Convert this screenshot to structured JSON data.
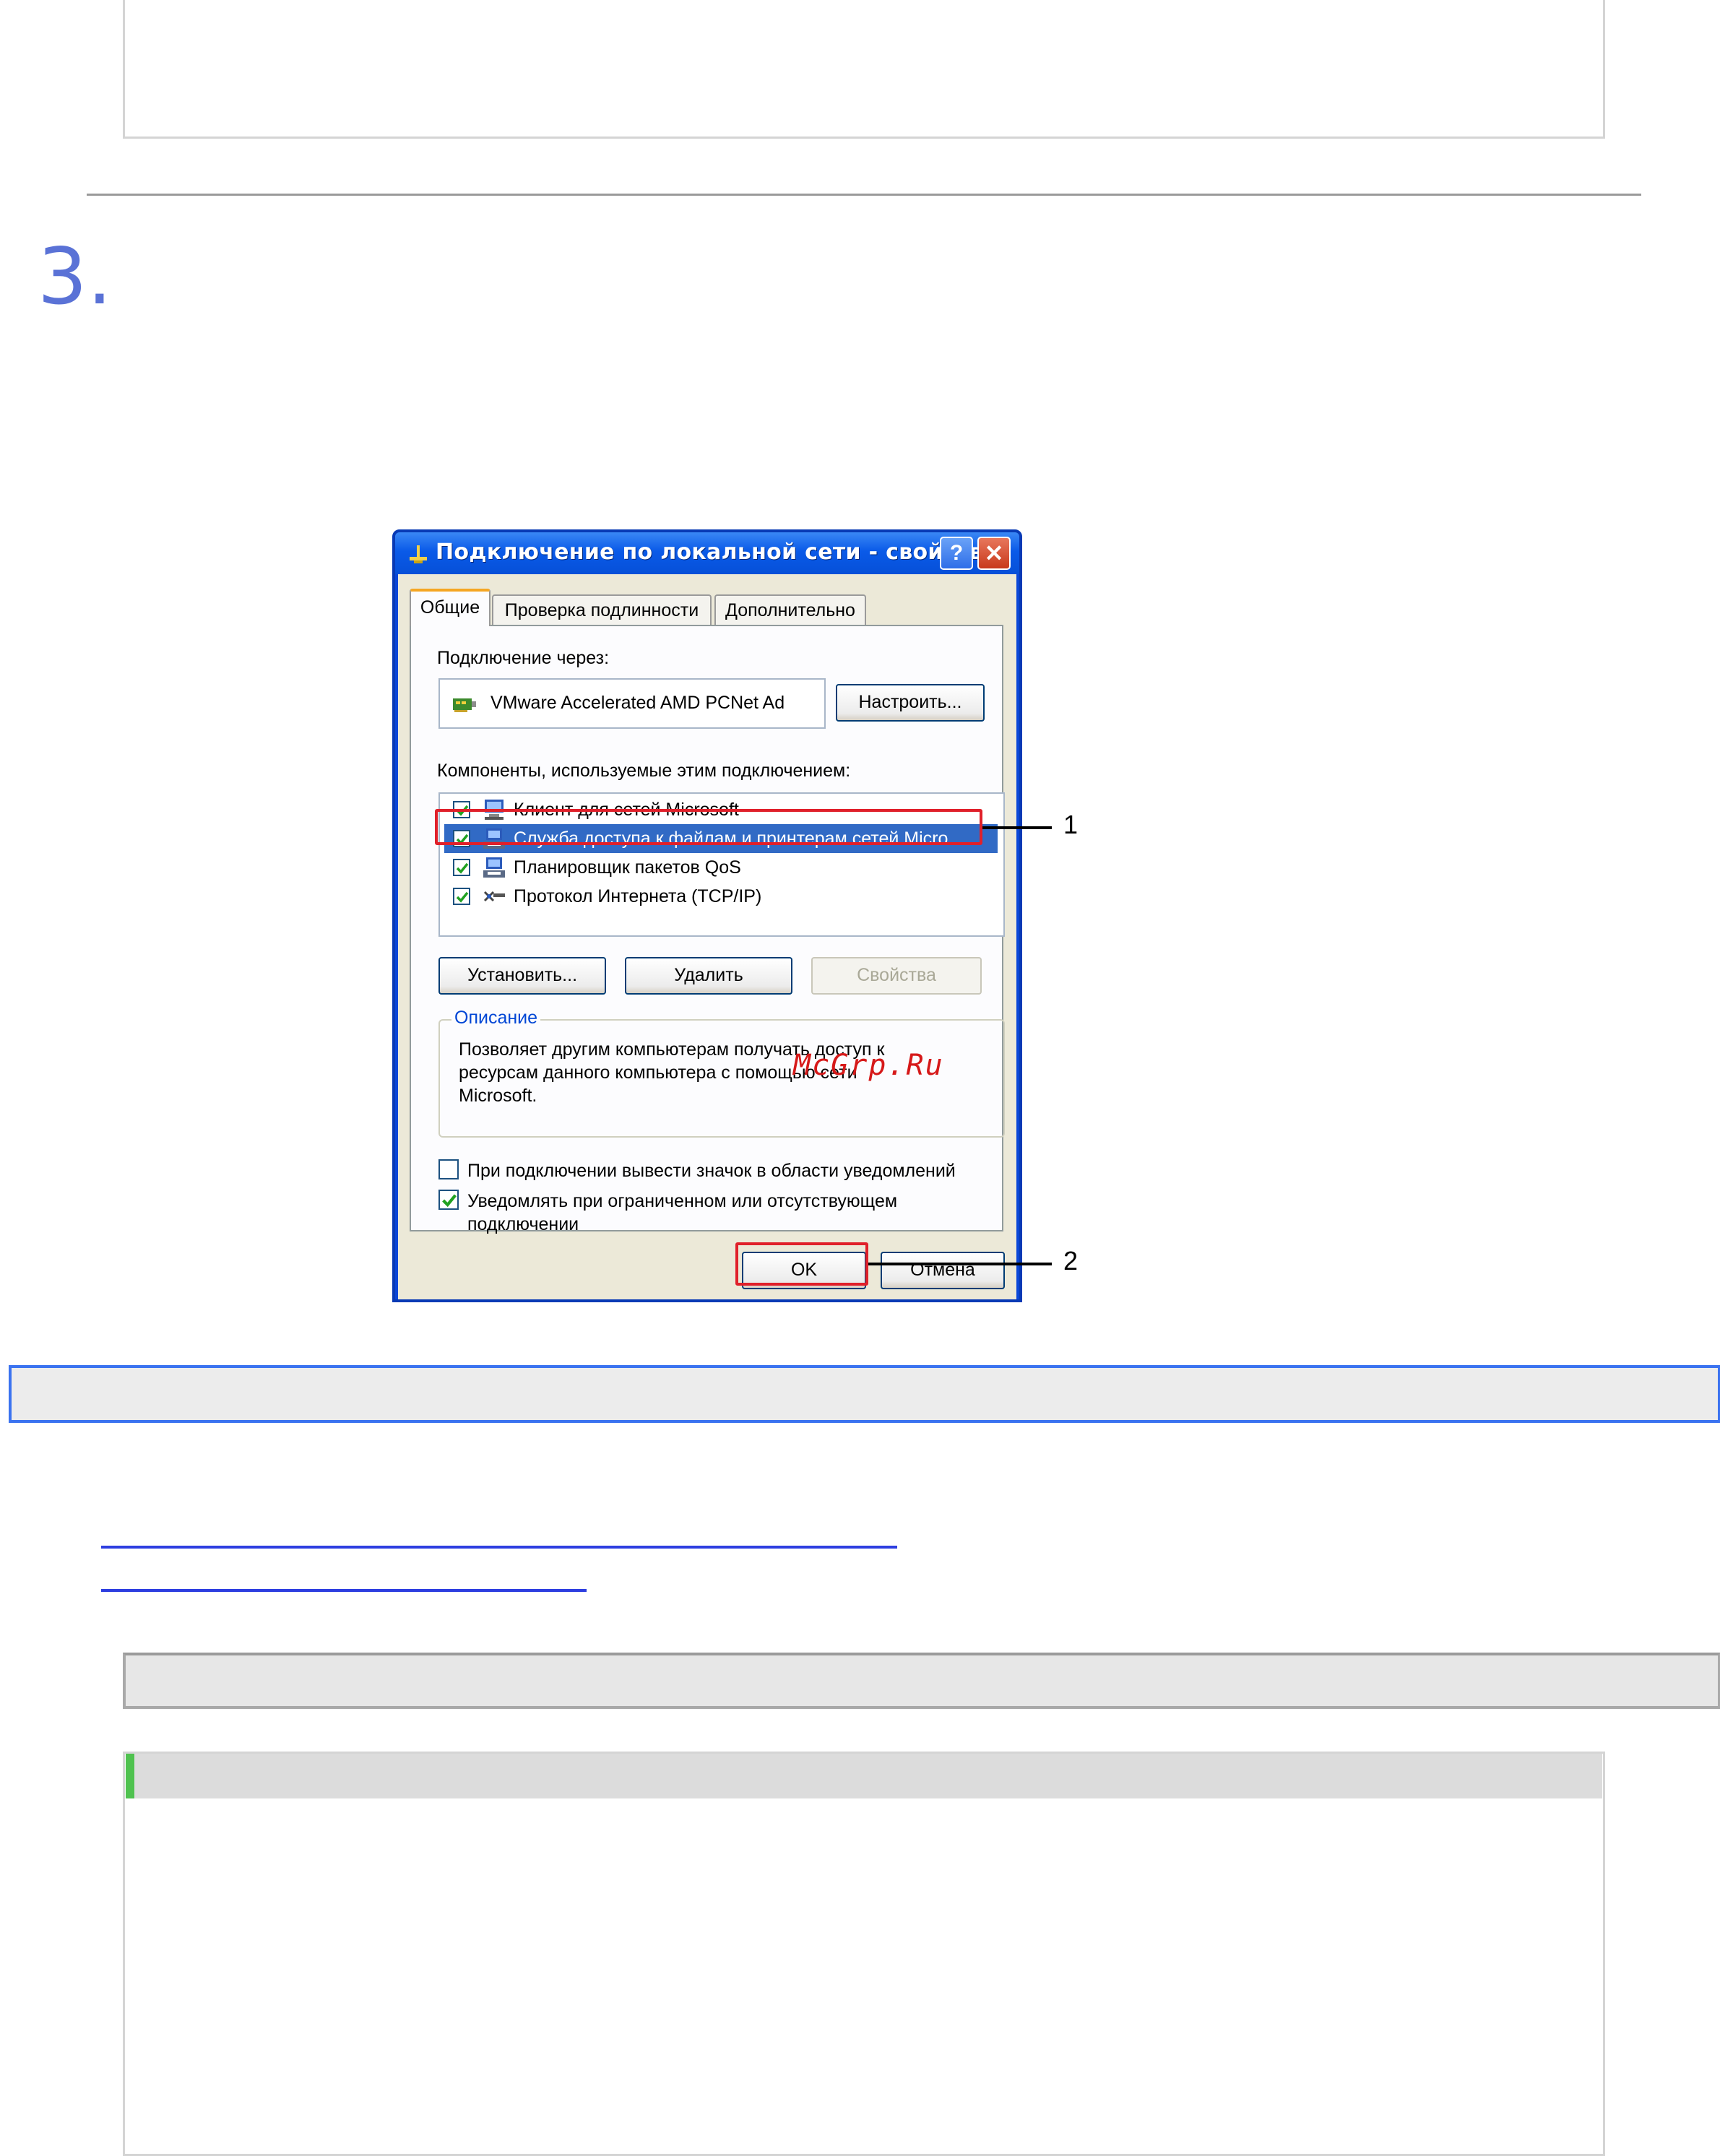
{
  "page": {
    "step_number": "3."
  },
  "dialog": {
    "title": "Подключение по локальной сети - свойства",
    "help_label": "?",
    "close_label": "✕",
    "tabs": [
      {
        "label": "Общие"
      },
      {
        "label": "Проверка подлинности"
      },
      {
        "label": "Дополнительно"
      }
    ],
    "connect_using_label": "Подключение через:",
    "adapter_name": "VMware Accelerated AMD PCNet Ad",
    "configure_button": "Настроить...",
    "components_label": "Компоненты, используемые этим подключением:",
    "components": [
      {
        "label": "Клиент для сетей Microsoft",
        "checked": true,
        "icon": "network-client-icon",
        "selected": false
      },
      {
        "label": "Служба доступа к файлам и принтерам сетей Micro...",
        "checked": true,
        "icon": "file-printer-service-icon",
        "selected": true
      },
      {
        "label": "Планировщик пакетов QoS",
        "checked": true,
        "icon": "qos-scheduler-icon",
        "selected": false
      },
      {
        "label": "Протокол Интернета (TCP/IP)",
        "checked": true,
        "icon": "network-protocol-icon",
        "selected": false
      }
    ],
    "install_button": "Установить...",
    "uninstall_button": "Удалить",
    "properties_button": "Свойства",
    "description_title": "Описание",
    "description_text": "Позволяет другим компьютерам получать доступ к ресурсам данного компьютера с помощью сети Microsoft.",
    "show_icon_option": {
      "label": "При подключении вывести значок в области уведомлений",
      "checked": false
    },
    "notify_option": {
      "label": "Уведомлять при ограниченном или отсутствующем подключении",
      "checked": true
    },
    "ok_button": "OK",
    "cancel_button": "Отмена"
  },
  "callouts": [
    {
      "number": "1"
    },
    {
      "number": "2"
    }
  ],
  "watermark": "McGrp.Ru",
  "colors": {
    "step_number": "#5a72d6",
    "titlebar": "#0a5ae8",
    "selection": "#316ac5",
    "callout_frame": "#e0202a",
    "info_bar_border": "#3b73f0",
    "link": "#2d3ee0"
  }
}
